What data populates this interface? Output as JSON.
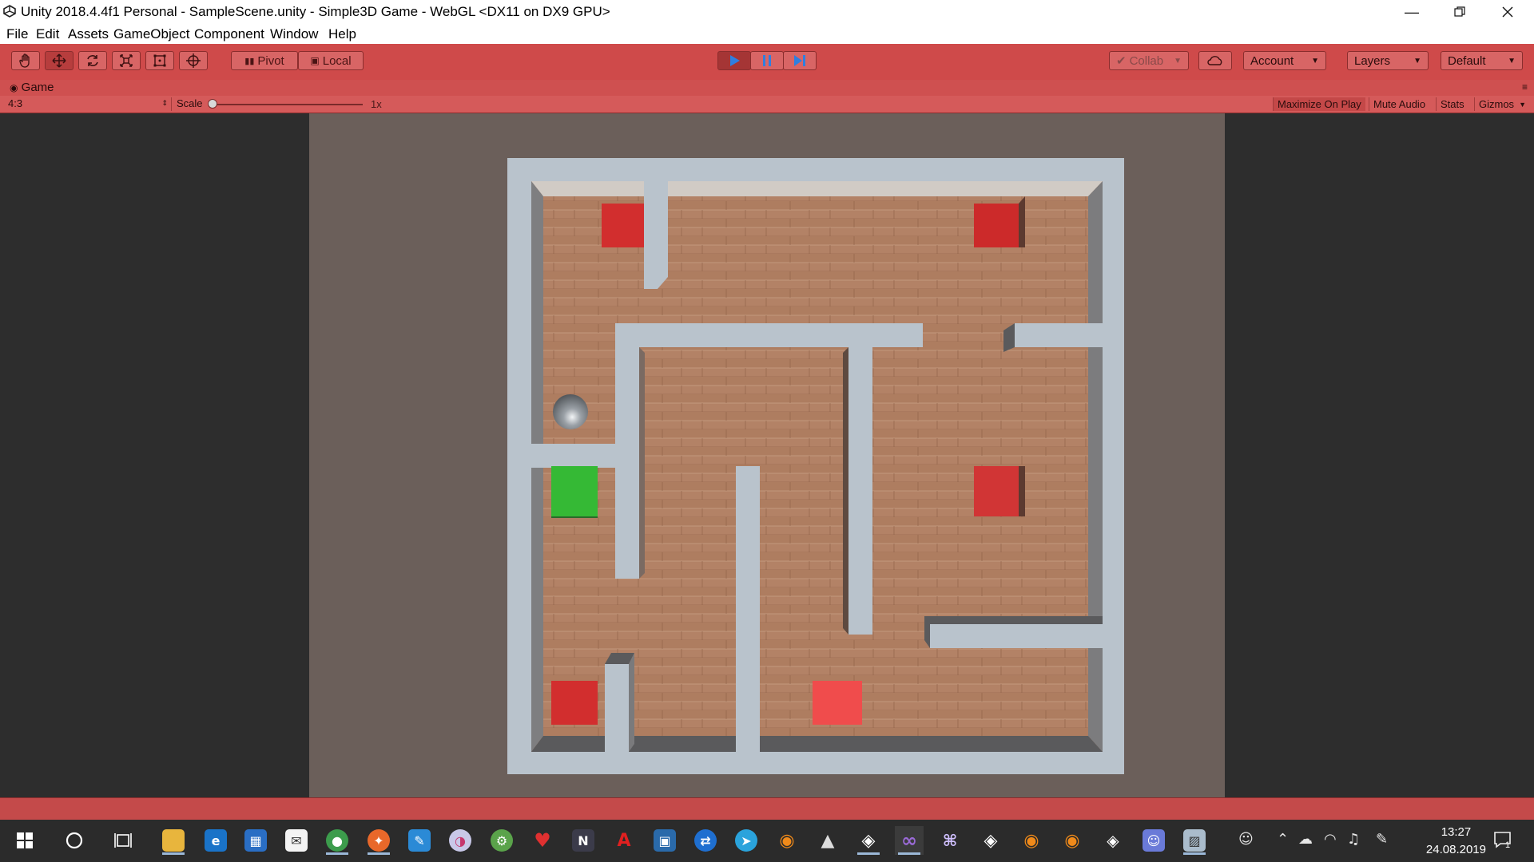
{
  "window": {
    "title": "Unity 2018.4.4f1 Personal - SampleScene.unity - Simple3D Game - WebGL <DX11 on DX9 GPU>",
    "controls": [
      "minimize",
      "restore",
      "close"
    ]
  },
  "menu": [
    "File",
    "Edit",
    "Assets",
    "GameObject",
    "Component",
    "Window",
    "Help"
  ],
  "toolbar": {
    "tools": [
      "hand-tool",
      "move-tool",
      "rotate-tool",
      "scale-tool",
      "rect-tool",
      "transform-tool"
    ],
    "active_tool": "move-tool",
    "pivot_label": "Pivot",
    "local_label": "Local",
    "play_state": "playing",
    "collab_label": "Collab",
    "account_label": "Account",
    "layers_label": "Layers",
    "layout_label": "Default"
  },
  "game_panel": {
    "tab_label": "Game",
    "aspect": "4:3",
    "scale_label": "Scale",
    "scale_value": "1x",
    "buttons": {
      "maximize": "Maximize On Play",
      "mute": "Mute Audio",
      "stats": "Stats",
      "gizmos": "Gizmos"
    },
    "maximize_active": true
  },
  "scene": {
    "description_items": [
      "maze-walls",
      "ball",
      "goal-tile",
      "red-tiles"
    ],
    "colors": {
      "wall": "#b9c3cc",
      "floor": "#b07d62",
      "goal": "#35b935",
      "hazard": "#d22e2e",
      "ball": "#9aa0a6",
      "background": "#6b5f5a"
    }
  },
  "taskbar": {
    "apps": [
      "start",
      "search",
      "task-view",
      "file-explorer",
      "edge",
      "store",
      "mail",
      "chrome",
      "firefox",
      "paint",
      "osu",
      "android-studio",
      "heart-app",
      "nuget",
      "acrobat",
      "cube-app",
      "teamviewer",
      "telegram",
      "blender",
      "inkscape",
      "unity",
      "visual-studio",
      "pixel-app",
      "unity-hub",
      "blender-2",
      "blender-3",
      "unity-3",
      "discord",
      "screenshot-app"
    ],
    "time": "13:27",
    "date": "24.08.2019",
    "notifications": "1"
  }
}
